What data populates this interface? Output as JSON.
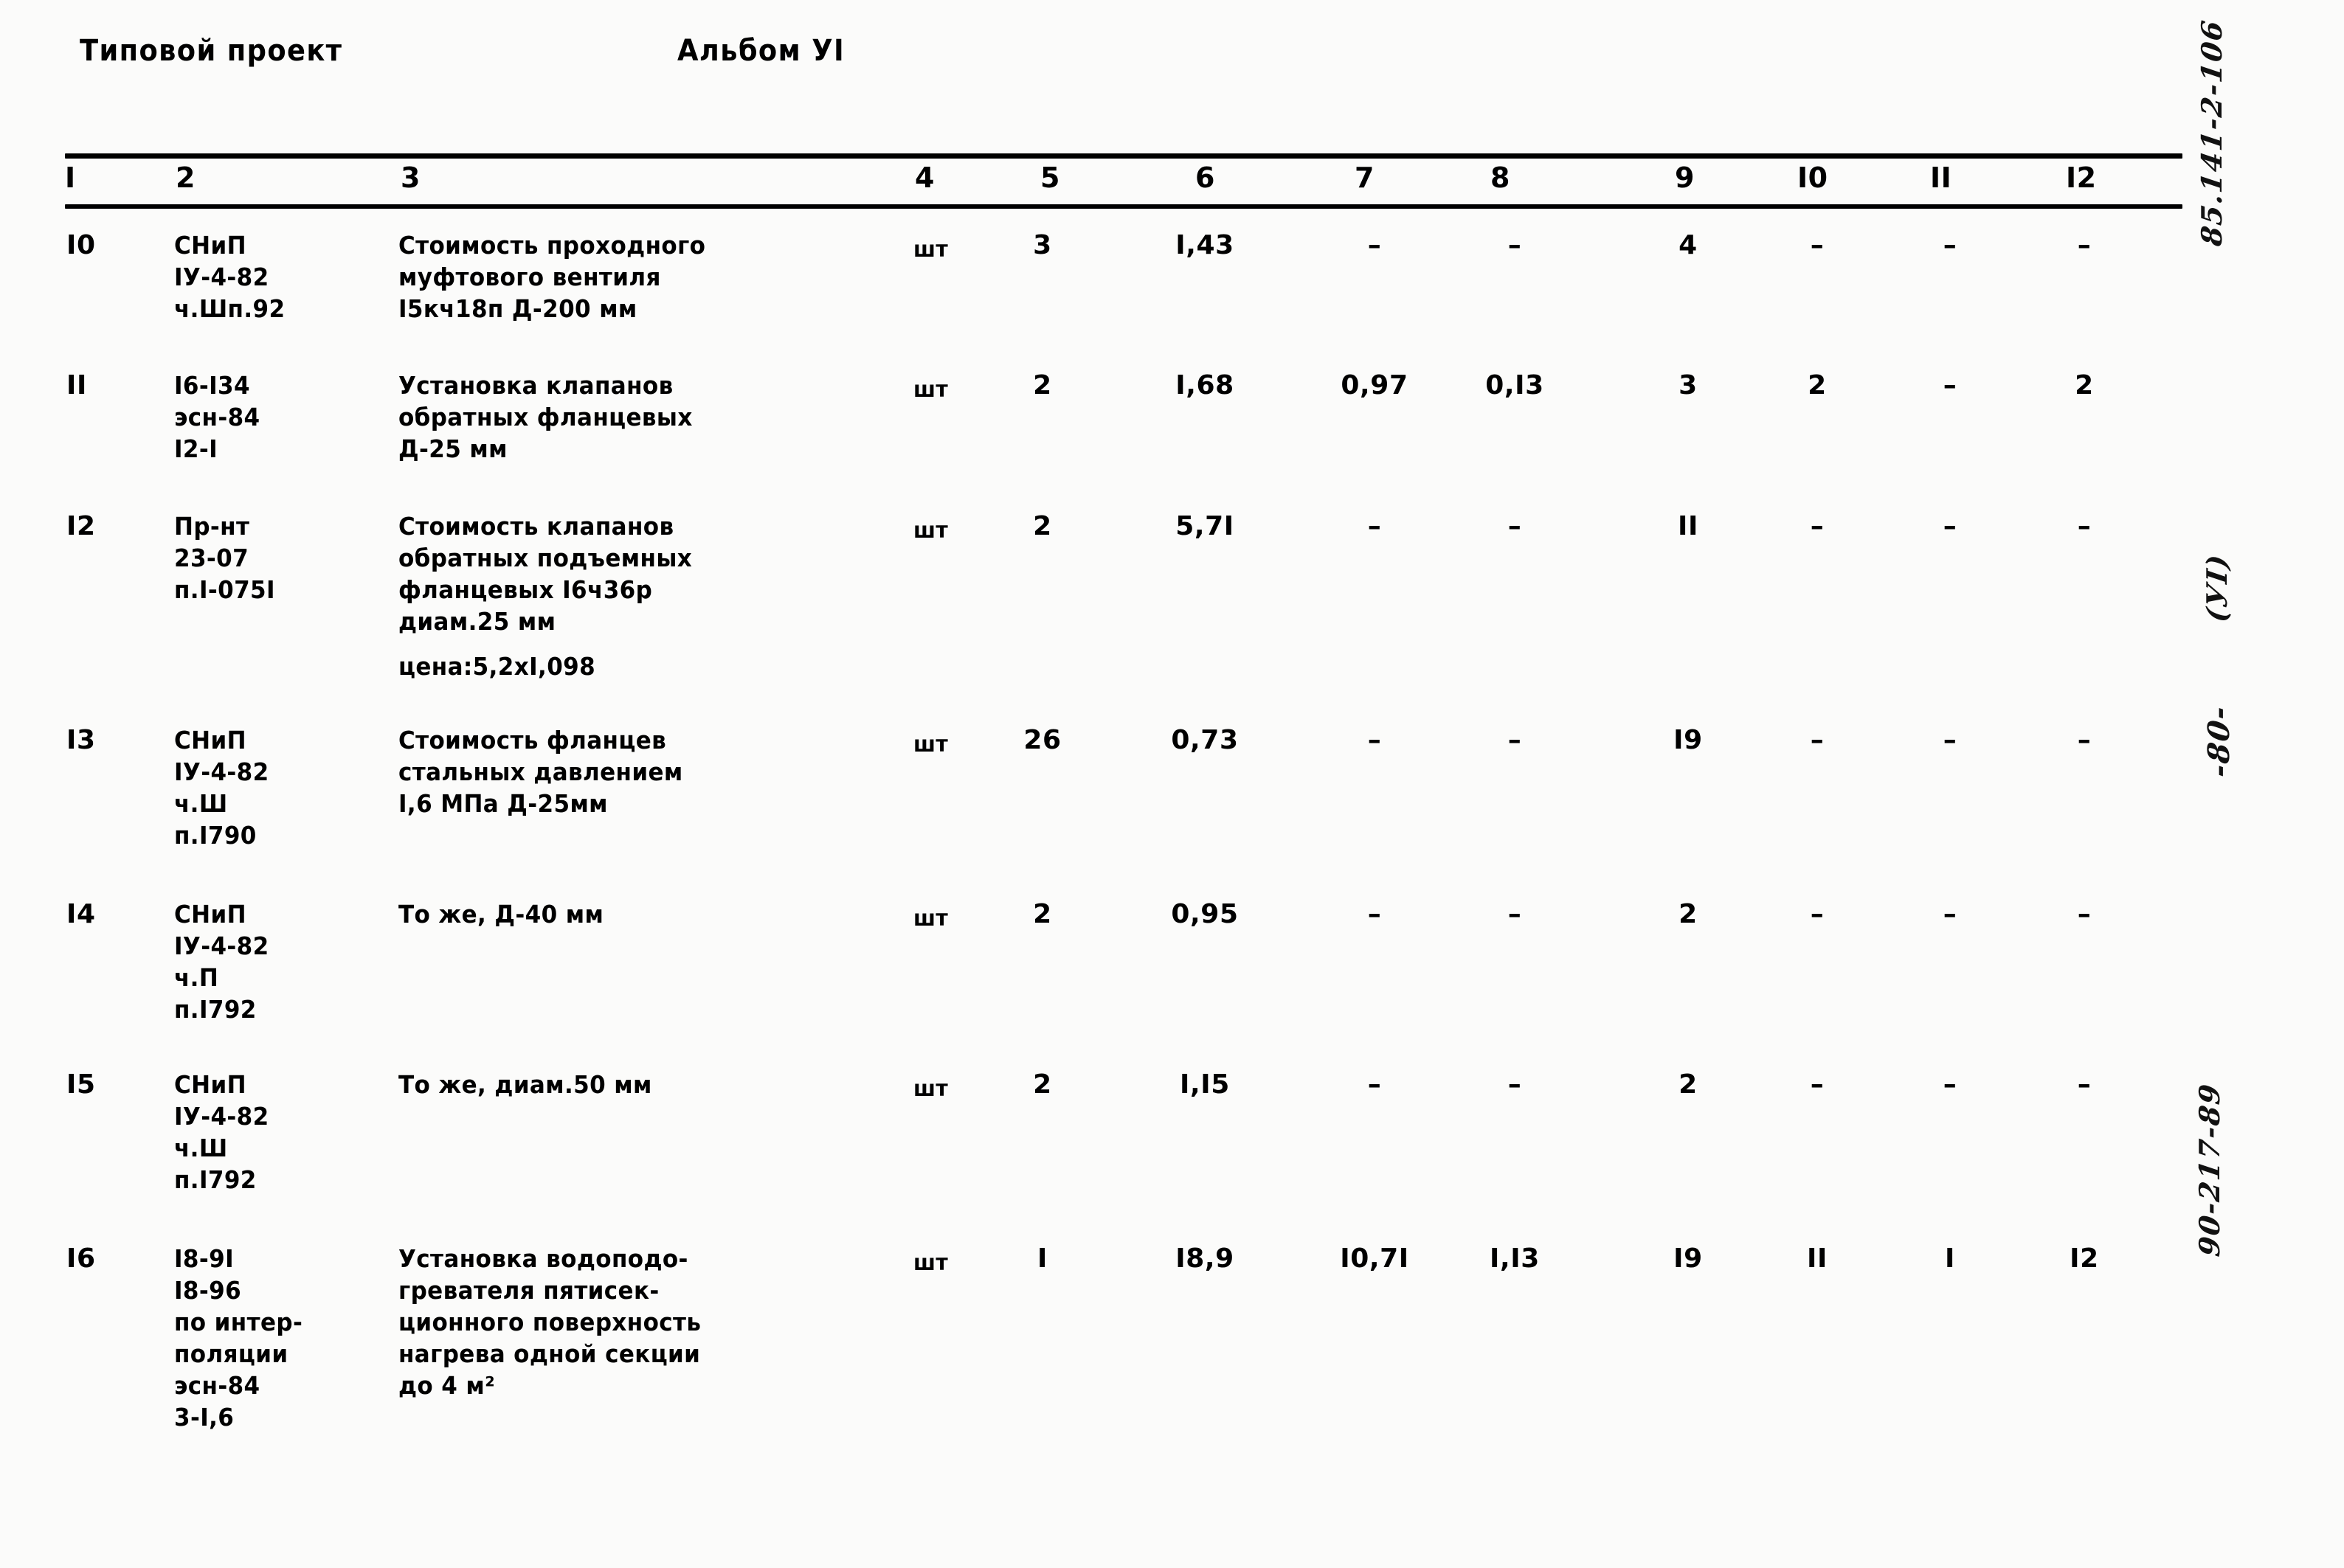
{
  "header": {
    "title": "Типовой проект",
    "album": "Альбом УI"
  },
  "table": {
    "column_headers": [
      "I",
      "2",
      "3",
      "4",
      "5",
      "6",
      "7",
      "8",
      "9",
      "I0",
      "II",
      "I2"
    ],
    "rows": [
      {
        "no": "I0",
        "code": "СНиП\nIУ-4-82\nч.Шп.92",
        "description": "Стоимость проходного\nмуфтового вентиля\nI5кч18п Д-200 мм",
        "price_note": "",
        "unit": "шт",
        "c5": "3",
        "c6": "I,43",
        "c7": "–",
        "c8": "–",
        "c9": "4",
        "c10": "–",
        "c11": "–",
        "c12": "–"
      },
      {
        "no": "II",
        "code": "I6-I34\nэсн-84\nI2-I",
        "description": "Установка клапанов\nобратных фланцевых\nД-25 мм",
        "price_note": "",
        "unit": "шт",
        "c5": "2",
        "c6": "I,68",
        "c7": "0,97",
        "c8": "0,I3",
        "c9": "3",
        "c10": "2",
        "c11": "–",
        "c12": "2"
      },
      {
        "no": "I2",
        "code": "Пр-нт\n23-07\nп.I-075I",
        "description": "Стоимость клапанов\nобратных подъемных\nфланцевых I6ч36р\nдиам.25 мм",
        "price_note": "цена:5,2хI,098",
        "unit": "шт",
        "c5": "2",
        "c6": "5,7I",
        "c7": "–",
        "c8": "–",
        "c9": "II",
        "c10": "–",
        "c11": "–",
        "c12": "–"
      },
      {
        "no": "I3",
        "code": "СНиП\nIУ-4-82\nч.Ш\nп.I790",
        "description": "Стоимость фланцев\nстальных давлением\nI,6 МПа Д-25мм",
        "price_note": "",
        "unit": "шт",
        "c5": "26",
        "c6": "0,73",
        "c7": "–",
        "c8": "–",
        "c9": "I9",
        "c10": "–",
        "c11": "–",
        "c12": "–"
      },
      {
        "no": "I4",
        "code": "СНиП\nIУ-4-82\nч.П\nп.I792",
        "description": "То же, Д-40 мм",
        "price_note": "",
        "unit": "шт",
        "c5": "2",
        "c6": "0,95",
        "c7": "–",
        "c8": "–",
        "c9": "2",
        "c10": "–",
        "c11": "–",
        "c12": "–"
      },
      {
        "no": "I5",
        "code": "СНиП\nIУ-4-82\nч.Ш\nп.I792",
        "description": "То же, диам.50 мм",
        "price_note": "",
        "unit": "шт",
        "c5": "2",
        "c6": "I,I5",
        "c7": "–",
        "c8": "–",
        "c9": "2",
        "c10": "–",
        "c11": "–",
        "c12": "–"
      },
      {
        "no": "I6",
        "code": "I8-9I\nI8-96\nпо интер-\nполяции\nэсн-84\n3-I,6",
        "description": "Установка водоподо-\nгревателя пятисек-\nционного поверхность\nнагрева одной секции\nдо 4 м²",
        "price_note": "",
        "unit": "шт",
        "c5": "I",
        "c6": "I8,9",
        "c7": "I0,7I",
        "c8": "I,I3",
        "c9": "I9",
        "c10": "II",
        "c11": "I",
        "c12": "I2"
      }
    ]
  },
  "margin_notes": {
    "top": "85.141-2-106",
    "album": "(УI)",
    "page": "-80-",
    "bottom": "90-217-89"
  }
}
